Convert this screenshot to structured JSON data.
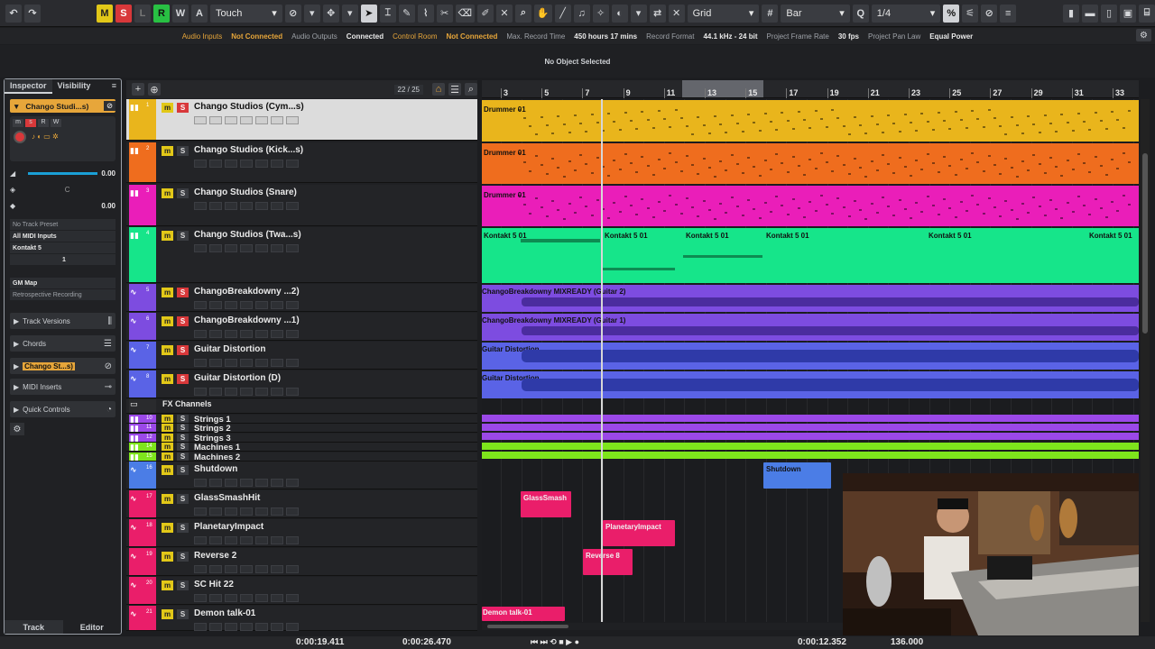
{
  "toolbar": {
    "modes": [
      "M",
      "S",
      "L",
      "R",
      "W",
      "A"
    ],
    "automation_mode": "Touch",
    "snap_type": "Grid",
    "grid_type": "Bar",
    "quantize": "1/4"
  },
  "status": {
    "audio_inputs_label": "Audio Inputs",
    "audio_inputs_value": "Not Connected",
    "audio_outputs_label": "Audio Outputs",
    "audio_outputs_value": "Connected",
    "control_room_label": "Control Room",
    "control_room_value": "Not Connected",
    "max_record_label": "Max. Record Time",
    "max_record_value": "450 hours 17 mins",
    "record_format_label": "Record Format",
    "record_format_value": "44.1 kHz - 24 bit",
    "frame_rate_label": "Project Frame Rate",
    "frame_rate_value": "30 fps",
    "pan_law_label": "Project Pan Law",
    "pan_law_value": "Equal Power"
  },
  "info_line": "No Object Selected",
  "inspector": {
    "tabs": [
      "Inspector",
      "Visibility"
    ],
    "track_name": "Chango Studi...s)",
    "volume": "0.00",
    "pan": "C",
    "delay": "0.00",
    "track_preset": "No Track Preset",
    "midi_input": "All MIDI Inputs",
    "instrument": "Kontakt 5",
    "channel": "1",
    "map": "GM Map",
    "retro": "Retrospective Recording",
    "sections": [
      "Track Versions",
      "Chords",
      "Chango St...s)",
      "MIDI Inserts",
      "Quick Controls"
    ],
    "bottom_tabs": [
      "Track",
      "Editor"
    ]
  },
  "tracklist": {
    "count": "22 / 25",
    "tracks": [
      {
        "name": "Chango Studios (Cym...s)",
        "num": "1",
        "type": "midi",
        "color": "#e9b51c",
        "s_red": true
      },
      {
        "name": "Chango Studios (Kick...s)",
        "num": "2",
        "type": "midi",
        "color": "#ef6d1e",
        "s_red": false
      },
      {
        "name": "Chango Studios (Snare)",
        "num": "3",
        "type": "midi",
        "color": "#ea1eb9",
        "s_red": false
      },
      {
        "name": "Chango Studios (Twa...s)",
        "num": "4",
        "type": "midi",
        "color": "#16e58a",
        "s_red": false
      },
      {
        "name": "ChangoBreakdowny ...2)",
        "num": "5",
        "type": "audio",
        "color": "#7d4ce0",
        "s_red": true
      },
      {
        "name": "ChangoBreakdowny ...1)",
        "num": "6",
        "type": "audio",
        "color": "#7d4ce0",
        "s_red": true
      },
      {
        "name": "Guitar Distortion",
        "num": "7",
        "type": "audio",
        "color": "#5a63e6",
        "s_red": true
      },
      {
        "name": "Guitar Distortion (D)",
        "num": "8",
        "type": "audio",
        "color": "#5a63e6",
        "s_red": true
      },
      {
        "name": "FX Channels",
        "num": "",
        "type": "folder",
        "color": "#2a2b2e",
        "s_red": false
      },
      {
        "name": "Strings 1",
        "num": "10",
        "type": "inst",
        "color": "#9b48e8",
        "s_red": false
      },
      {
        "name": "Strings 2",
        "num": "11",
        "type": "inst",
        "color": "#9b48e8",
        "s_red": false
      },
      {
        "name": "Strings 3",
        "num": "12",
        "type": "inst",
        "color": "#9b48e8",
        "s_red": false
      },
      {
        "name": "Machines 1",
        "num": "14",
        "type": "inst",
        "color": "#7ee51c",
        "s_red": false
      },
      {
        "name": "Machines 2",
        "num": "15",
        "type": "inst",
        "color": "#7ee51c",
        "s_red": false
      },
      {
        "name": "Shutdown",
        "num": "16",
        "type": "audio",
        "color": "#4b7de6",
        "s_red": false
      },
      {
        "name": "GlassSmashHit",
        "num": "17",
        "type": "audio",
        "color": "#ea1e6a",
        "s_red": false
      },
      {
        "name": "PlanetaryImpact",
        "num": "18",
        "type": "audio",
        "color": "#ea1e6a",
        "s_red": false
      },
      {
        "name": "Reverse 2",
        "num": "19",
        "type": "audio",
        "color": "#ea1e6a",
        "s_red": false
      },
      {
        "name": "SC Hit 22",
        "num": "20",
        "type": "audio",
        "color": "#ea1e6a",
        "s_red": false
      },
      {
        "name": "Demon talk-01",
        "num": "21",
        "type": "audio",
        "color": "#ea1e6a",
        "s_red": false
      }
    ]
  },
  "ruler": {
    "bars": [
      "3",
      "5",
      "7",
      "9",
      "11",
      "13",
      "15",
      "17",
      "19",
      "21",
      "23",
      "25",
      "27",
      "29",
      "31",
      "33"
    ]
  },
  "clips": {
    "cym": "Drummer 01",
    "kick": "Drummer 01",
    "snare": "Drummer 01",
    "kontakt": [
      "Kontakt 5 01",
      "Kontakt 5 01",
      "Kontakt 5 01",
      "Kontakt 5 01",
      "Kontakt 5 01",
      "Kontakt 5 01"
    ],
    "breakdown2": "ChangoBreakdowny MIXREADY (Guitar 2)",
    "breakdown1": "ChangoBreakdowny MIXREADY (Guitar 1)",
    "guitar": "Guitar Distortion",
    "guitar_d": "Guitar Distortion",
    "shutdown": "Shutdown",
    "glass": "GlassSmash",
    "planetary": "PlanetaryImpact",
    "reverse": "Reverse 8",
    "demon": "Demon talk-01"
  },
  "transport": {
    "left_locator": "0:00:19.411",
    "right_locator": "0:00:26.470",
    "position": "0:00:12.352",
    "tempo": "136.000"
  }
}
